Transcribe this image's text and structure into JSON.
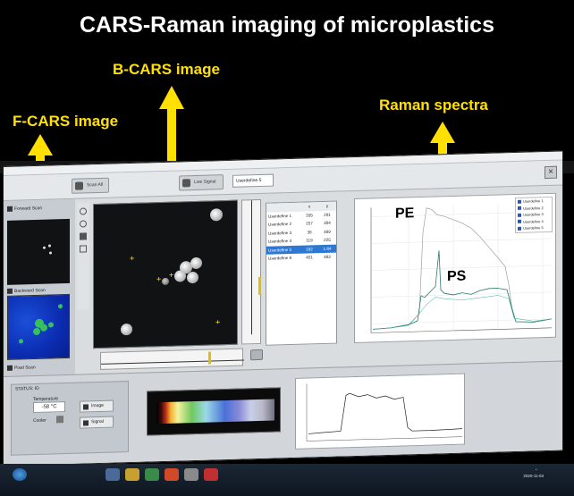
{
  "title": "CARS-Raman imaging of microplastics",
  "labels": {
    "fcars": "F-CARS image",
    "bcars": "B-CARS image",
    "raman": "Raman spectra"
  },
  "spectrum_annotations": {
    "pe": "PE",
    "ps": "PS"
  },
  "toolbar": {
    "buttons": [
      "Scan All",
      "Live Signal"
    ],
    "combo_value": "Userdefine 5",
    "close_glyph": "×"
  },
  "scan_panels": {
    "forward": "Forward Scan",
    "backward": "Backward Scan",
    "pixel": "Pixel Scan"
  },
  "point_table": {
    "headers": [
      "",
      "x",
      "y"
    ],
    "rows": [
      [
        "Userdefine 1",
        "335",
        "291"
      ],
      [
        "Userdefine 2",
        "257",
        "304"
      ],
      [
        "Userdefine 3",
        "39",
        "469"
      ],
      [
        "Userdefine 4",
        "119",
        "225"
      ],
      [
        "Userdefine 5",
        "182",
        "1.64"
      ],
      [
        "Userdefine 6",
        "451",
        "463"
      ]
    ],
    "selected_index": 4
  },
  "legend": [
    "Userdefine 1",
    "Userdefine 2",
    "Userdefine 3",
    "Userdefine 4",
    "Userdefine 5"
  ],
  "status": {
    "header": "STATUS: ID",
    "temperature_label": "Temperature",
    "temperature": "-58 °C",
    "cooler_label": "Cooler",
    "image_button": "Image",
    "signal_button": "Signal"
  },
  "colors": {
    "accent_yellow": "#ffe000",
    "raman_curve_pe": "#a0a0a0",
    "raman_curve_ps": "#2a7a6a",
    "selected_row": "#2d78d2"
  },
  "clock": {
    "time": "°      ",
    "date": "2020-11-03"
  }
}
